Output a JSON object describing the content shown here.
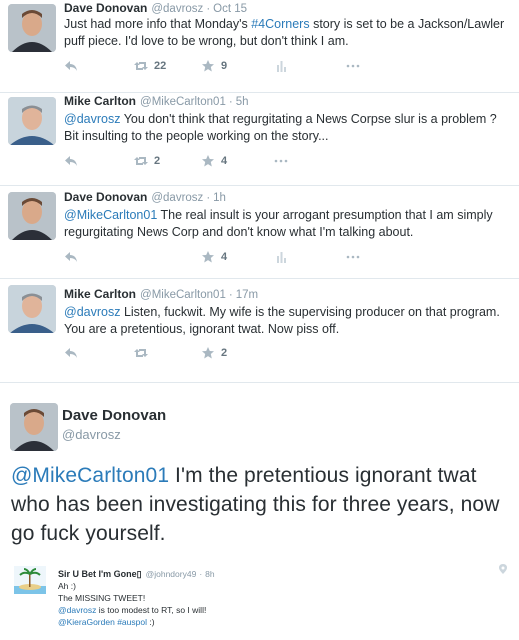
{
  "colors": {
    "link": "#2b7bb9",
    "muted": "#8899a6",
    "text": "#292f33",
    "divider": "#e1e8ed"
  },
  "tweets": [
    {
      "name": "Dave Donovan",
      "handle": "@davrosz",
      "time": "Oct 15",
      "text_a": "Just had more info that Monday's ",
      "hashtag": "#4Corners",
      "text_b": " story is set to be a Jackson/Lawler puff piece. I'd love to be wrong, but don't think I am.",
      "retweets": "22",
      "favorites": "9"
    },
    {
      "name": "Mike Carlton",
      "handle": "@MikeCarlton01",
      "time": "5h",
      "mention": "@davrosz",
      "text": " You don't think that regurgitating a News Corpse slur is a problem ? Bit insulting to the people working on the story...",
      "retweets": "2",
      "favorites": "4"
    },
    {
      "name": "Dave Donovan",
      "handle": "@davrosz",
      "time": "1h",
      "mention": "@MikeCarlton01",
      "text": " The real insult is your arrogant presumption that I am simply regurgitating News Corp and don't know what I'm talking about.",
      "favorites": "4"
    },
    {
      "name": "Mike Carlton",
      "handle": "@MikeCarlton01",
      "time": "17m",
      "mention": "@davrosz",
      "text": " Listen, fuckwit. My wife is the supervising producer on that program. You are a pretentious, ignorant twat. Now piss off.",
      "favorites": "2"
    }
  ],
  "big_tweet": {
    "name": "Dave Donovan",
    "handle": "@davrosz",
    "mention": "@MikeCarlton01",
    "text": " I'm the pretentious ignorant twat who has been investigating this for three years, now go fuck yourself."
  },
  "last_tweet": {
    "name": "Sir U Bet I'm Gone▯",
    "handle": "@johndory49",
    "time": "8h",
    "line1": "Ah :)",
    "line2": "The MISSING TWEET!",
    "line3_mention": "@davrosz",
    "line3_text": " is too modest to RT, so I will!",
    "line4_mention": "@KieraGorden",
    "line4_hashtag": "#auspol",
    "line4_text": " :)"
  },
  "icons": [
    "reply-icon",
    "retweet-icon",
    "favorite-icon",
    "stats-icon",
    "more-icon",
    "location-pin-icon"
  ]
}
